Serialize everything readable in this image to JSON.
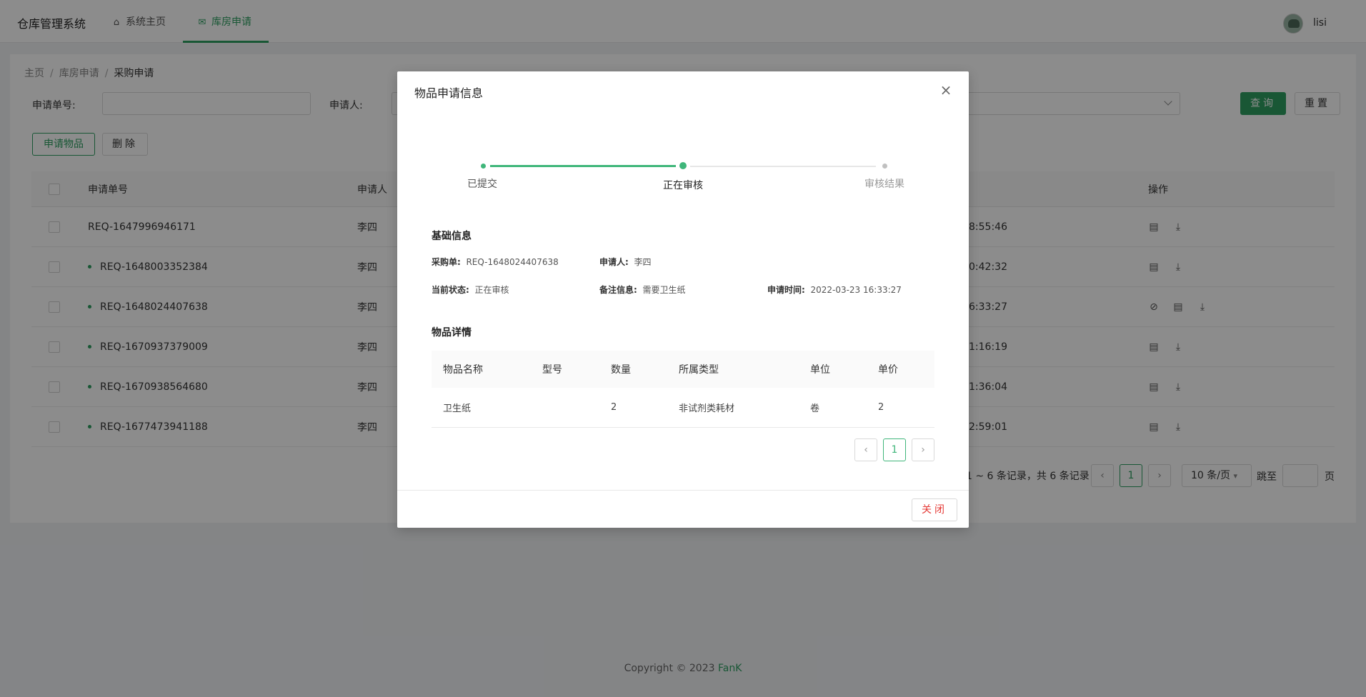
{
  "header": {
    "brand": "仓库管理系统",
    "nav": [
      {
        "label": "系统主页",
        "icon": "home-icon"
      },
      {
        "label": "库房申请",
        "icon": "mailbox-icon"
      }
    ],
    "user": "lisi"
  },
  "breadcrumb": [
    "主页",
    "库房申请",
    "采购申请"
  ],
  "filters": {
    "request_no_label": "申请单号:",
    "applicant_label": "申请人:"
  },
  "buttons": {
    "query": "查询",
    "reset": "重置",
    "apply": "申请物品",
    "delete": "删除"
  },
  "table": {
    "columns": [
      "申请单号",
      "申请人",
      "操作"
    ],
    "rows": [
      {
        "id": "REQ-1647996946171",
        "applicant": "李四",
        "time": "8:55:46",
        "dot": false
      },
      {
        "id": "REQ-1648003352384",
        "applicant": "李四",
        "time": "0:42:32",
        "dot": true
      },
      {
        "id": "REQ-1648024407638",
        "applicant": "李四",
        "time": "6:33:27",
        "dot": true
      },
      {
        "id": "REQ-1670937379009",
        "applicant": "李四",
        "time": "1:16:19",
        "dot": true
      },
      {
        "id": "REQ-1670938564680",
        "applicant": "李四",
        "time": "1:36:04",
        "dot": true
      },
      {
        "id": "REQ-1677473941188",
        "applicant": "李四",
        "time": "2:59:01",
        "dot": true
      }
    ]
  },
  "pagination": {
    "info": "1 ~ 6 条记录，共 6 条记录",
    "current": "1",
    "page_size": "10 条/页",
    "jump_to": "跳至",
    "page_unit": "页"
  },
  "footer": {
    "copyright": "Copyright © 2023",
    "author": "FanK"
  },
  "modal": {
    "title": "物品申请信息",
    "steps": [
      "已提交",
      "正在审核",
      "审核结果"
    ],
    "basic_title": "基础信息",
    "basic": {
      "order_label": "采购单:",
      "order_value": "REQ-1648024407638",
      "applicant_label": "申请人:",
      "applicant_value": "李四",
      "status_label": "当前状态:",
      "status_value": "正在审核",
      "remark_label": "备注信息:",
      "remark_value": "需要卫生纸",
      "time_label": "申请时间:",
      "time_value": "2022-03-23 16:33:27"
    },
    "detail_title": "物品详情",
    "detail_columns": [
      "物品名称",
      "型号",
      "数量",
      "所属类型",
      "单位",
      "单价"
    ],
    "detail_rows": [
      {
        "name": "卫生纸",
        "model": "",
        "qty": "2",
        "type": "非试剂类耗材",
        "unit": "卷",
        "price": "2"
      }
    ],
    "page": "1",
    "close_label": "关闭"
  },
  "colors": {
    "accent": "#2e9e62",
    "close_text": "#e53935"
  }
}
